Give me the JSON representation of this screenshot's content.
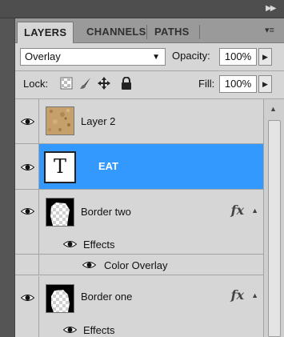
{
  "tabs": [
    {
      "label": "LAYERS",
      "active": true
    },
    {
      "label": "CHANNELS",
      "active": false
    },
    {
      "label": "PATHS",
      "active": false
    }
  ],
  "controls": {
    "blend_mode": "Overlay",
    "opacity_label": "Opacity:",
    "opacity_value": "100%",
    "lock_label": "Lock:",
    "fill_label": "Fill:",
    "fill_value": "100%"
  },
  "layers": [
    {
      "name": "Layer 2",
      "thumbnail": "texture",
      "visible": true,
      "selected": false
    },
    {
      "name": "EAT",
      "thumbnail": "type-T",
      "visible": true,
      "selected": true,
      "thumb_glyph": "T"
    },
    {
      "name": "Border two",
      "thumbnail": "mask",
      "visible": true,
      "selected": false,
      "fx": "fx",
      "effects_label": "Effects",
      "effects": [
        "Color Overlay"
      ]
    },
    {
      "name": "Border one",
      "thumbnail": "mask",
      "visible": true,
      "selected": false,
      "fx": "fx",
      "effects_label": "Effects"
    }
  ],
  "icons": {
    "eye": "eye-icon",
    "lock_transparency": "lock-transparent-pixels-icon",
    "lock_image": "brush-icon",
    "lock_position": "move-icon",
    "lock_all": "padlock-icon",
    "panel_menu": "panel-menu-icon",
    "collapse": "collapse-icon"
  },
  "colors": {
    "selected_row": "#3399ff",
    "panel_bg": "#d6d6d6"
  }
}
